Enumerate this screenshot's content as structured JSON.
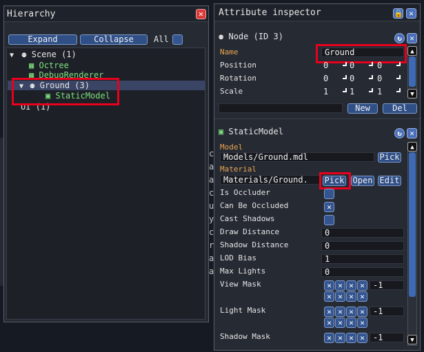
{
  "hierarchy": {
    "title": "Hierarchy",
    "expand_label": "Expand",
    "collapse_label": "Collapse",
    "all_label": "All",
    "items": [
      {
        "label": "Scene (1)"
      },
      {
        "label": "Octree"
      },
      {
        "label": "DebugRenderer"
      },
      {
        "label": "Ground (3)"
      },
      {
        "label": "StaticModel"
      },
      {
        "label": "UI (1)"
      }
    ]
  },
  "inspector": {
    "title": "Attribute inspector",
    "node": {
      "header": "Node (ID 3)",
      "name_label": "Name",
      "name_value": "Ground",
      "position_label": "Position",
      "position_values": [
        "0",
        "0",
        "0"
      ],
      "rotation_label": "Rotation",
      "rotation_values": [
        "0",
        "0",
        "0"
      ],
      "scale_label": "Scale",
      "scale_values": [
        "1",
        "1",
        "1"
      ],
      "new_label": "New",
      "del_label": "Del"
    },
    "component": {
      "header": "StaticModel",
      "model_label": "Model",
      "model_value": "Models/Ground.mdl",
      "pick_label": "Pick",
      "material_label": "Material",
      "material_value": "Materials/Ground.",
      "open_label": "Open",
      "edit_label": "Edit",
      "attributes": [
        {
          "label": "Is Occluder",
          "type": "check",
          "checked": false
        },
        {
          "label": "Can Be Occluded",
          "type": "check",
          "checked": true
        },
        {
          "label": "Cast Shadows",
          "type": "check",
          "checked": false
        },
        {
          "label": "Draw Distance",
          "type": "num",
          "value": "0"
        },
        {
          "label": "Shadow Distance",
          "type": "num",
          "value": "0"
        },
        {
          "label": "LOD Bias",
          "type": "num",
          "value": "1"
        },
        {
          "label": "Max Lights",
          "type": "num",
          "value": "0"
        }
      ],
      "view_mask_label": "View Mask",
      "light_mask_label": "Light Mask",
      "shadow_mask_label": "Shadow Mask",
      "mask_value": "-1"
    }
  },
  "background": {
    "glyphs": [
      "c",
      "a",
      "a",
      "c",
      "u",
      "y",
      "c",
      "r",
      "a",
      "a"
    ]
  },
  "colors": {
    "accent_red": "#e8001c",
    "button_blue": "#2f4f86",
    "orange_label": "#e8a550",
    "green_text": "#7de07d"
  }
}
